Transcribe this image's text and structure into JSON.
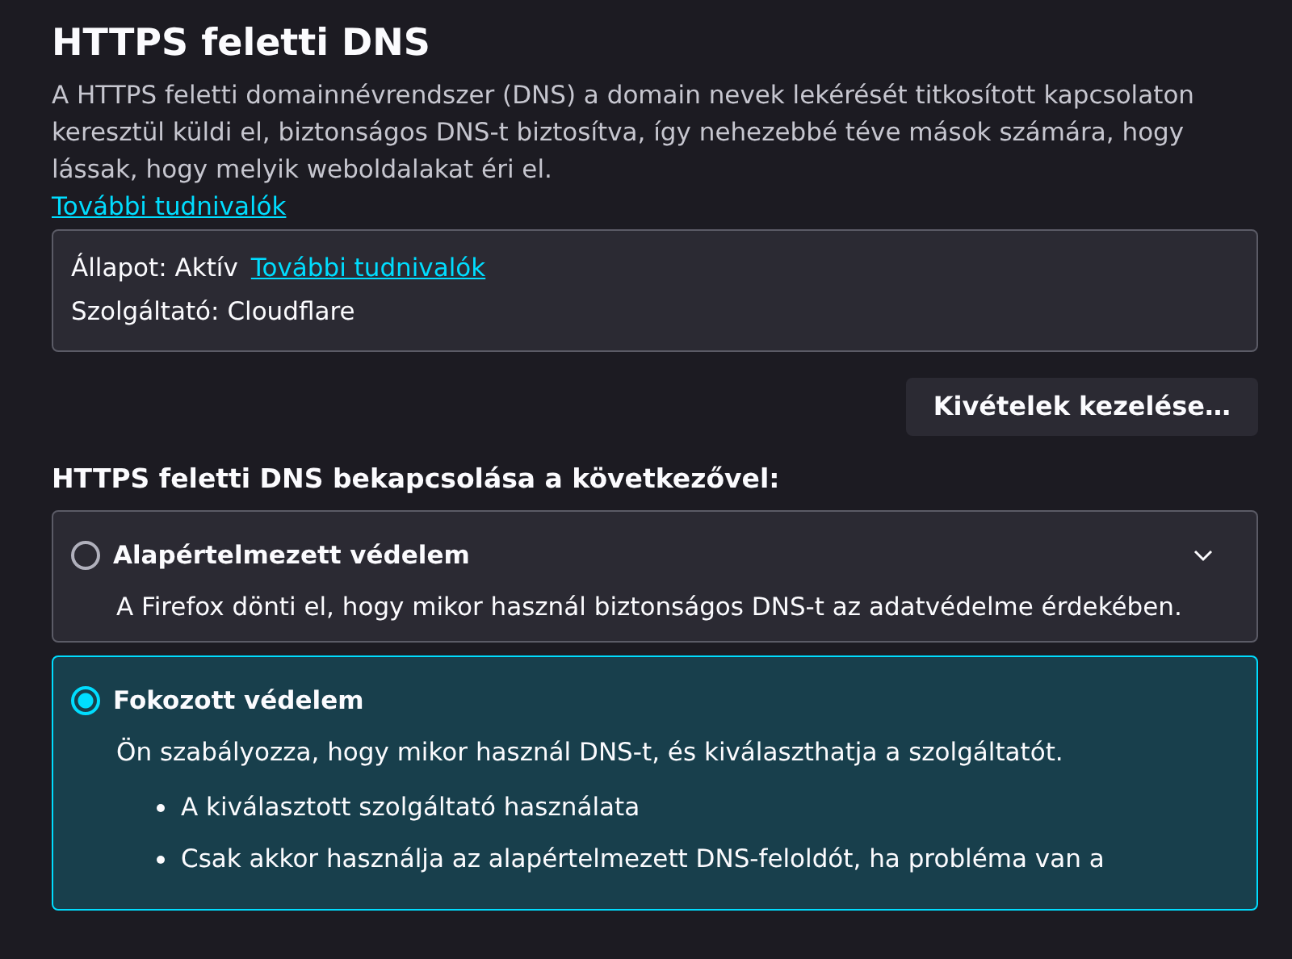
{
  "section": {
    "title": "HTTPS feletti DNS",
    "description": "A HTTPS feletti domainnévrendszer (DNS) a domain nevek lekérését titkosított kapcsolaton keresztül küldi el, biztonságos DNS-t biztosítva, így nehezebbé téve mások számára, hogy lássak, hogy melyik weboldalakat éri el.",
    "learn_more_link": "További tudnivalók"
  },
  "status_box": {
    "status": "Állapot: Aktív",
    "status_link": "További tudnivalók",
    "provider": "Szolgáltató: Cloudflare"
  },
  "exceptions_button": "Kivételek kezelése…",
  "options_heading": "HTTPS feletti DNS bekapcsolása a következővel:",
  "options": [
    {
      "label": "Alapértelmezett védelem",
      "description": "A Firefox dönti el, hogy mikor használ biztonságos DNS-t az adatvédelme érdekében.",
      "selected": false,
      "expanded": false
    },
    {
      "label": "Fokozott védelem",
      "description": "Ön szabályozza, hogy mikor használ DNS-t, és kiválaszthatja a szolgáltatót.",
      "selected": true,
      "expanded": true,
      "bullets": [
        "A kiválasztott szolgáltató használata",
        "Csak akkor használja az alapértelmezett DNS-feloldót, ha probléma van a"
      ]
    }
  ]
}
